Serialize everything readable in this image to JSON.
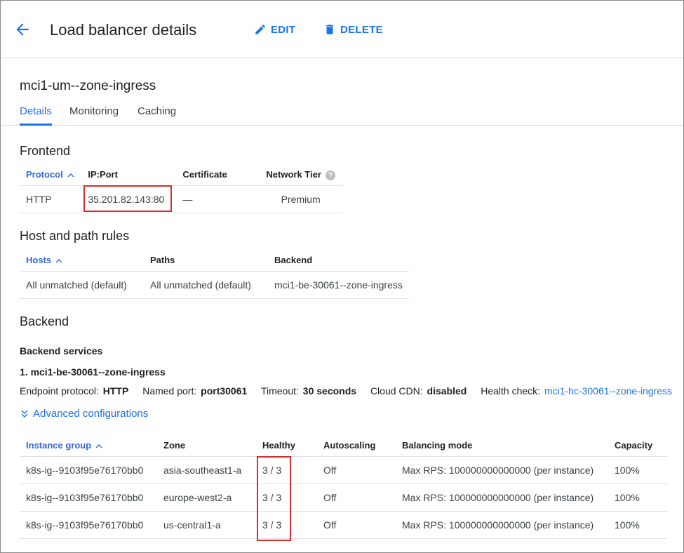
{
  "header": {
    "title": "Load balancer details",
    "edit_label": "EDIT",
    "delete_label": "DELETE"
  },
  "lb_name": "mci1-um--zone-ingress",
  "tabs": [
    "Details",
    "Monitoring",
    "Caching"
  ],
  "frontend": {
    "title": "Frontend",
    "columns": [
      "Protocol",
      "IP:Port",
      "Certificate",
      "Network Tier"
    ],
    "row": {
      "protocol": "HTTP",
      "ip_port": "35.201.82.143:80",
      "certificate": "—",
      "network_tier": "Premium"
    },
    "help_glyph": "?"
  },
  "host_rules": {
    "title": "Host and path rules",
    "columns": [
      "Hosts",
      "Paths",
      "Backend"
    ],
    "row": {
      "hosts": "All unmatched (default)",
      "paths": "All unmatched (default)",
      "backend": "mci1-be-30061--zone-ingress"
    }
  },
  "backend": {
    "title": "Backend",
    "services_title": "Backend services",
    "item": "1. mci1-be-30061--zone-ingress",
    "meta": {
      "endpoint_protocol_key": "Endpoint protocol:",
      "endpoint_protocol_val": "HTTP",
      "named_port_key": "Named port:",
      "named_port_val": "port30061",
      "timeout_key": "Timeout:",
      "timeout_val": "30 seconds",
      "cdn_key": "Cloud CDN:",
      "cdn_val": "disabled",
      "health_key": "Health check:",
      "health_link": "mci1-hc-30061--zone-ingress"
    },
    "advanced_label": "Advanced configurations",
    "columns": [
      "Instance group",
      "Zone",
      "Healthy",
      "Autoscaling",
      "Balancing mode",
      "Capacity"
    ],
    "rows": [
      {
        "group": "k8s-ig--9103f95e76170bb0",
        "zone": "asia-southeast1-a",
        "healthy": "3 / 3",
        "autoscaling": "Off",
        "mode": "Max RPS: 100000000000000 (per instance)",
        "capacity": "100%"
      },
      {
        "group": "k8s-ig--9103f95e76170bb0",
        "zone": "europe-west2-a",
        "healthy": "3 / 3",
        "autoscaling": "Off",
        "mode": "Max RPS: 100000000000000 (per instance)",
        "capacity": "100%"
      },
      {
        "group": "k8s-ig--9103f95e76170bb0",
        "zone": "us-central1-a",
        "healthy": "3 / 3",
        "autoscaling": "Off",
        "mode": "Max RPS: 100000000000000 (per instance)",
        "capacity": "100%"
      }
    ]
  },
  "colors": {
    "accent": "#1a73e8",
    "highlight": "#d32f2f"
  }
}
